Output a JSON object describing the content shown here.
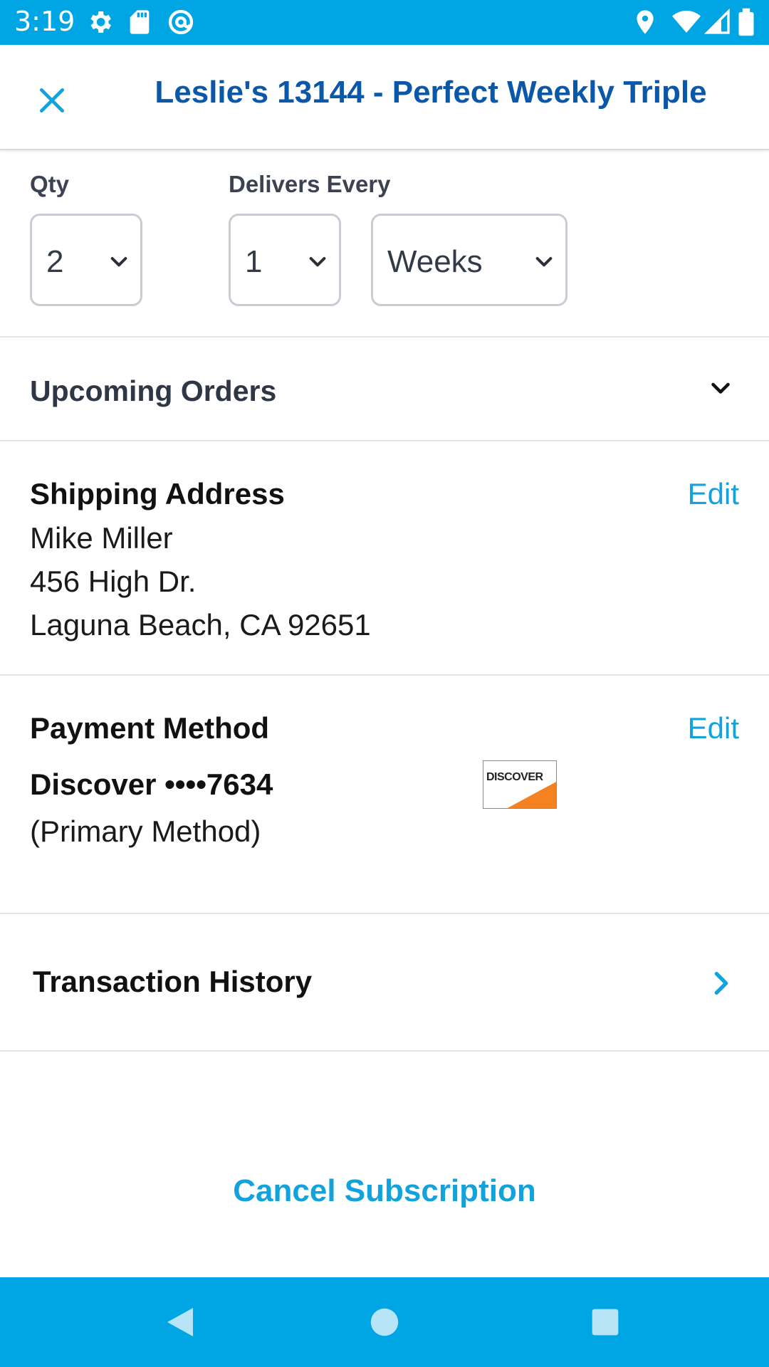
{
  "status_bar": {
    "time": "3:19",
    "left_icons": [
      "gear-icon",
      "sd-card-icon",
      "at-sign-icon"
    ],
    "right_icons": [
      "location-pin-icon",
      "wifi-icon",
      "signal-icon",
      "battery-icon"
    ]
  },
  "header": {
    "title": "Leslie's 13144 - Perfect Weekly Triple",
    "close_icon": "close-icon"
  },
  "subscription": {
    "qty_label": "Qty",
    "qty_value": "2",
    "delivers_label": "Delivers Every",
    "interval_value": "1",
    "unit_value": "Weeks"
  },
  "upcoming": {
    "label": "Upcoming Orders"
  },
  "shipping": {
    "title": "Shipping Address",
    "edit_label": "Edit",
    "name": "Mike Miller",
    "street": "456 High Dr.",
    "city_line": "Laguna Beach, CA 92651"
  },
  "payment": {
    "title": "Payment Method",
    "edit_label": "Edit",
    "card": "Discover ••••7634",
    "note": "(Primary Method)",
    "logo_text": "DISCOVER"
  },
  "transactions": {
    "label": "Transaction History"
  },
  "actions": {
    "cancel_label": "Cancel Subscription"
  },
  "colors": {
    "brand_blue": "#00a6e4",
    "title_blue": "#0b58a8",
    "link_blue": "#12a3dc",
    "discover_orange": "#f58220"
  },
  "nav_bar": {
    "buttons": [
      "back-icon",
      "home-icon",
      "recents-icon"
    ]
  }
}
